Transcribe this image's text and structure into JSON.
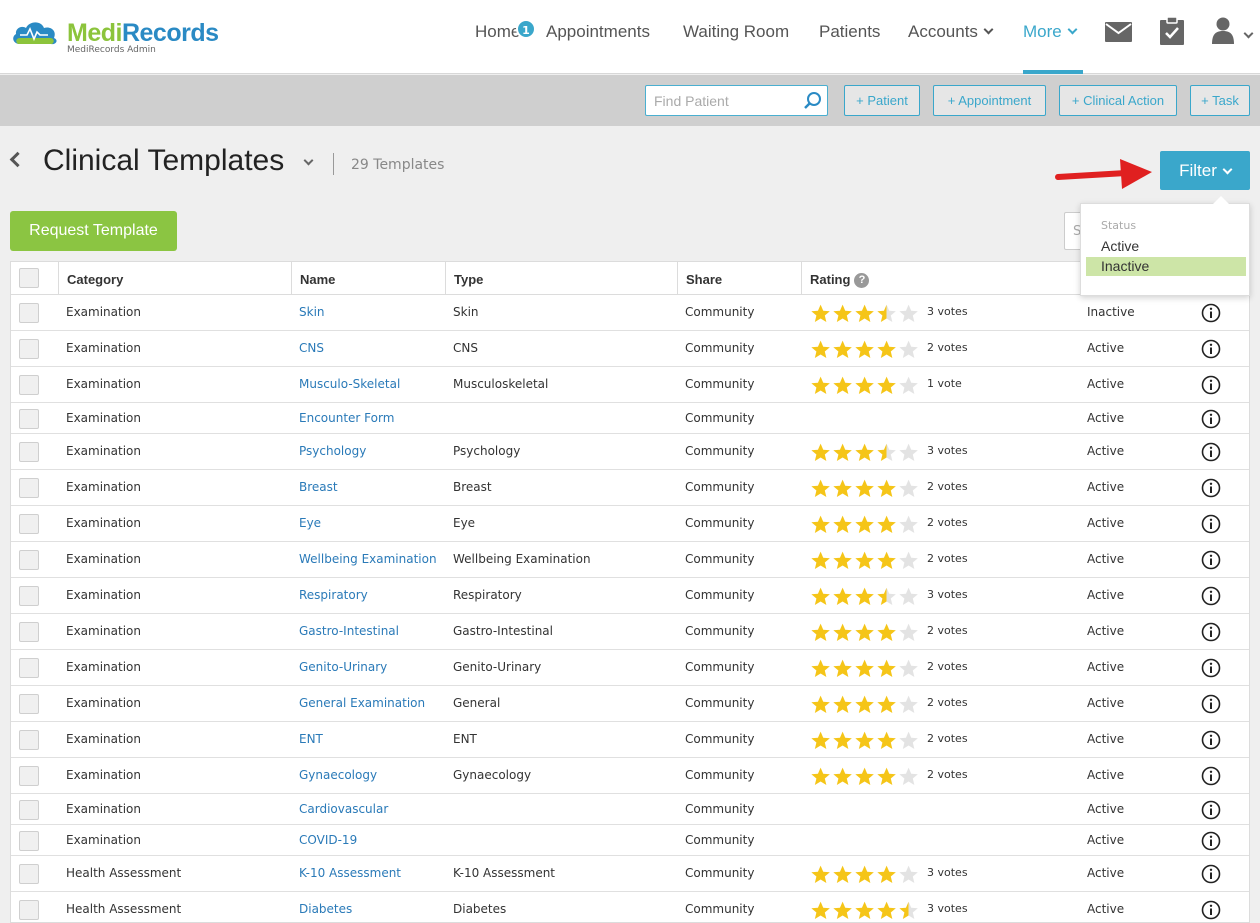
{
  "brand": {
    "name_part1": "Medi",
    "name_part2": "Records",
    "subtitle": "MediRecords Admin"
  },
  "nav": {
    "home": "Home",
    "home_badge": "1",
    "appointments": "Appointments",
    "waiting_room": "Waiting Room",
    "patients": "Patients",
    "accounts": "Accounts",
    "more": "More"
  },
  "actionbar": {
    "find_placeholder": "Find Patient",
    "add_patient": "+ Patient",
    "add_appointment": "+ Appointment",
    "add_clinical_action": "+ Clinical Action",
    "add_task": "+ Task"
  },
  "page": {
    "title": "Clinical Templates",
    "count": "29 Templates",
    "filter": "Filter",
    "request": "Request Template",
    "search_stub": "S"
  },
  "filter_menu": {
    "heading": "Status",
    "options": [
      "Active",
      "Inactive"
    ],
    "selected": "Inactive"
  },
  "table": {
    "headers": {
      "category": "Category",
      "name": "Name",
      "type": "Type",
      "share": "Share",
      "rating": "Rating",
      "rating_help": "?"
    },
    "rows": [
      {
        "category": "Examination",
        "name": "Skin",
        "type": "Skin",
        "share": "Community",
        "rating": 3.5,
        "votes": "3 votes",
        "status": "Inactive"
      },
      {
        "category": "Examination",
        "name": "CNS",
        "type": "CNS",
        "share": "Community",
        "rating": 4,
        "votes": "2 votes",
        "status": "Active"
      },
      {
        "category": "Examination",
        "name": "Musculo-Skeletal",
        "type": "Musculoskeletal",
        "share": "Community",
        "rating": 4,
        "votes": "1 vote",
        "status": "Active"
      },
      {
        "category": "Examination",
        "name": "Encounter Form",
        "type": "",
        "share": "Community",
        "rating": 0,
        "votes": "",
        "status": "Active"
      },
      {
        "category": "Examination",
        "name": "Psychology",
        "type": "Psychology",
        "share": "Community",
        "rating": 3.5,
        "votes": "3 votes",
        "status": "Active"
      },
      {
        "category": "Examination",
        "name": "Breast",
        "type": "Breast",
        "share": "Community",
        "rating": 4,
        "votes": "2 votes",
        "status": "Active"
      },
      {
        "category": "Examination",
        "name": "Eye",
        "type": "Eye",
        "share": "Community",
        "rating": 4,
        "votes": "2 votes",
        "status": "Active"
      },
      {
        "category": "Examination",
        "name": "Wellbeing Examination",
        "type": "Wellbeing Examination",
        "share": "Community",
        "rating": 4,
        "votes": "2 votes",
        "status": "Active"
      },
      {
        "category": "Examination",
        "name": "Respiratory",
        "type": "Respiratory",
        "share": "Community",
        "rating": 3.5,
        "votes": "3 votes",
        "status": "Active"
      },
      {
        "category": "Examination",
        "name": "Gastro-Intestinal",
        "type": "Gastro-Intestinal",
        "share": "Community",
        "rating": 4,
        "votes": "2 votes",
        "status": "Active"
      },
      {
        "category": "Examination",
        "name": "Genito-Urinary",
        "type": "Genito-Urinary",
        "share": "Community",
        "rating": 4,
        "votes": "2 votes",
        "status": "Active"
      },
      {
        "category": "Examination",
        "name": "General Examination",
        "type": "General",
        "share": "Community",
        "rating": 4,
        "votes": "2 votes",
        "status": "Active"
      },
      {
        "category": "Examination",
        "name": "ENT",
        "type": "ENT",
        "share": "Community",
        "rating": 4,
        "votes": "2 votes",
        "status": "Active"
      },
      {
        "category": "Examination",
        "name": "Gynaecology",
        "type": "Gynaecology",
        "share": "Community",
        "rating": 4,
        "votes": "2 votes",
        "status": "Active"
      },
      {
        "category": "Examination",
        "name": "Cardiovascular",
        "type": "",
        "share": "Community",
        "rating": 0,
        "votes": "",
        "status": "Active"
      },
      {
        "category": "Examination",
        "name": "COVID-19",
        "type": "",
        "share": "Community",
        "rating": 0,
        "votes": "",
        "status": "Active"
      },
      {
        "category": "Health Assessment",
        "name": "K-10 Assessment",
        "type": "K-10 Assessment",
        "share": "Community",
        "rating": 4,
        "votes": "3 votes",
        "status": "Active"
      },
      {
        "category": "Health Assessment",
        "name": "Diabetes",
        "type": "Diabetes",
        "share": "Community",
        "rating": 4.5,
        "votes": "3 votes",
        "status": "Active"
      }
    ]
  },
  "colors": {
    "accent": "#3aa7cb",
    "green": "#8bc542",
    "star": "#f5c518",
    "star_empty": "#e3e3e3",
    "link": "#2a7ab8",
    "arrow": "#e02020"
  },
  "icons": {
    "mail": "mail-icon",
    "clipboard": "clipboard-check-icon",
    "user": "user-icon",
    "search": "search-icon",
    "info": "info-icon"
  }
}
